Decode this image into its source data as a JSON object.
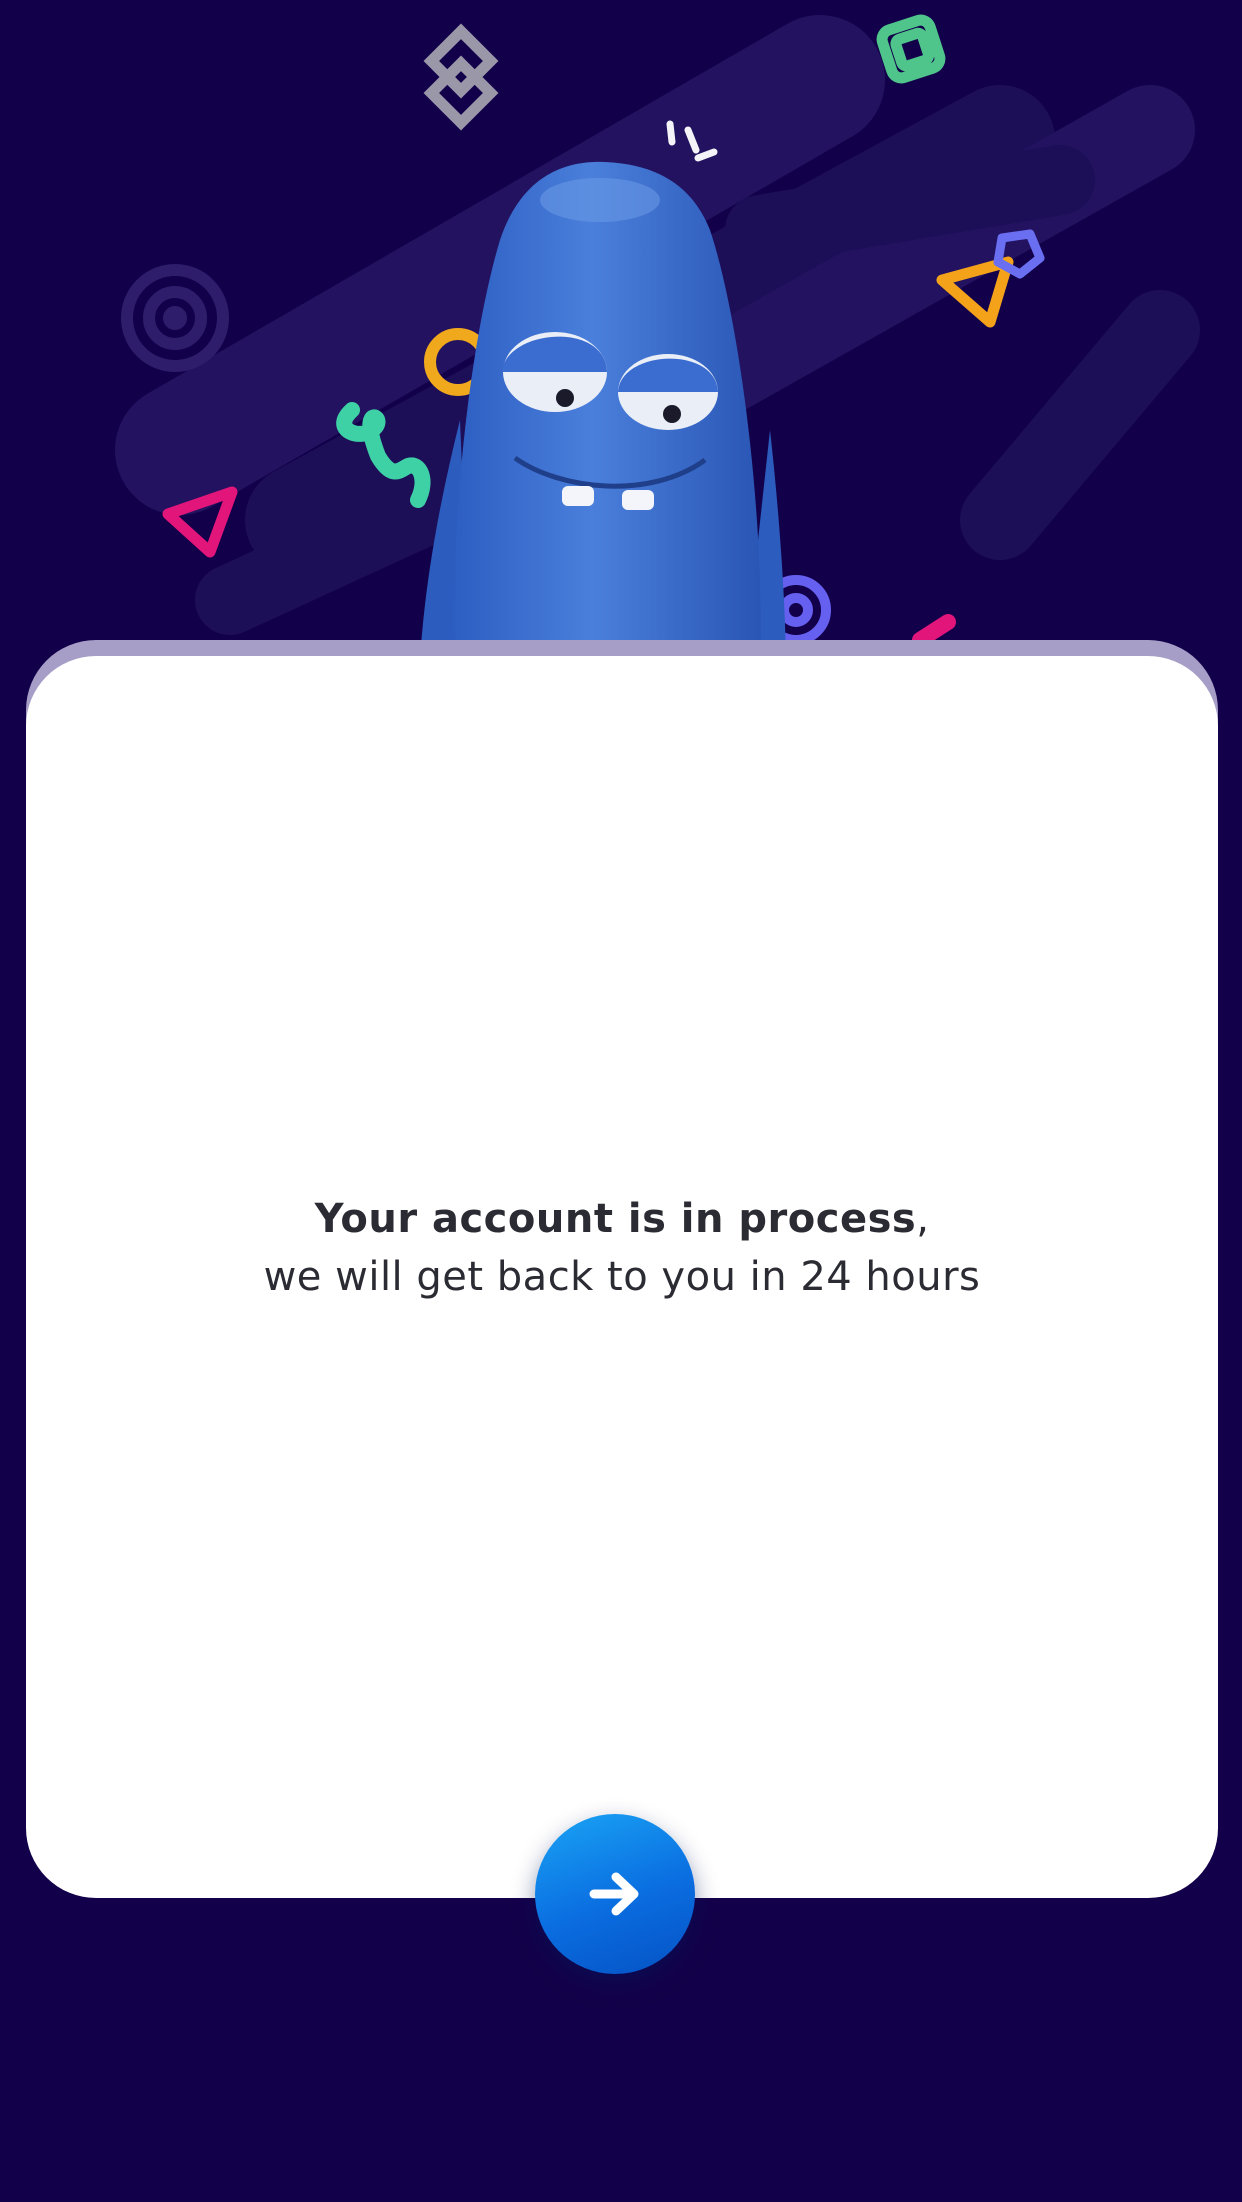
{
  "message": {
    "strong": "Your account is in process",
    "comma": ",",
    "line2": "we will get back to you in 24 hours"
  },
  "next_button": {
    "icon": "arrow-right-icon"
  },
  "colors": {
    "background": "#13004a",
    "card": "#ffffff",
    "button": "#0a6de0",
    "mascot": "#3d6fcf"
  }
}
